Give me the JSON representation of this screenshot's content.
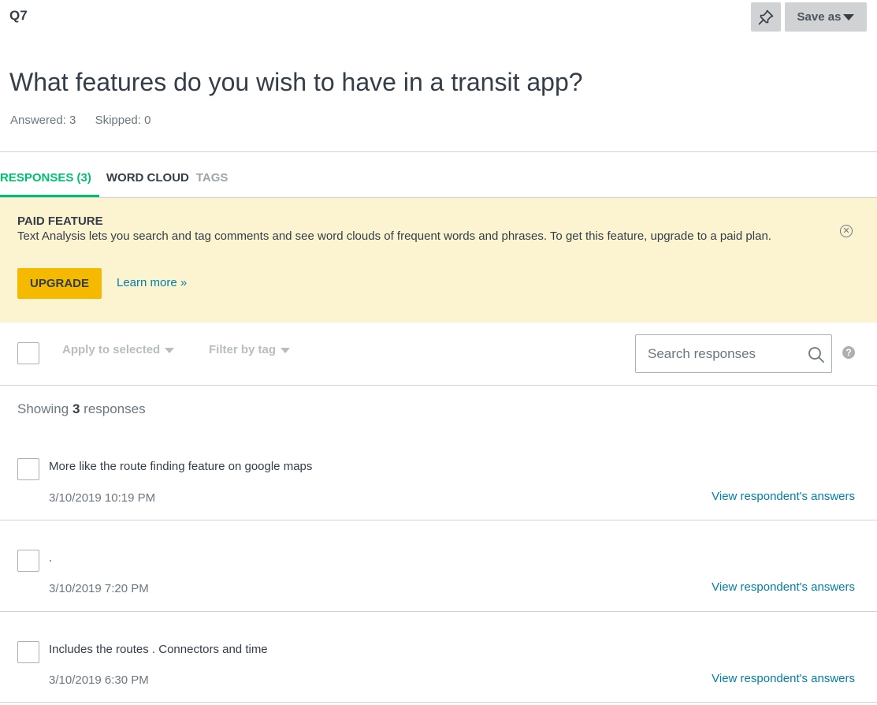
{
  "question": {
    "number": "Q7",
    "title": "What features do you wish to have in a transit app?",
    "answered": "Answered: 3",
    "skipped": "Skipped: 0"
  },
  "header": {
    "save_as_label": "Save as",
    "pin_icon": "pin-icon"
  },
  "tabs": [
    {
      "label": "RESPONSES (3)",
      "state": "active"
    },
    {
      "label": "WORD CLOUD",
      "state": "normal"
    },
    {
      "label": "TAGS",
      "state": "muted"
    }
  ],
  "paid_banner": {
    "title": "PAID FEATURE",
    "text": "Text Analysis lets you search and tag comments and see word clouds of frequent words and phrases. To get this feature, upgrade to a paid plan.",
    "upgrade_label": "UPGRADE",
    "learn_more_label": "Learn more »",
    "close_icon": "close-circle-icon"
  },
  "toolbar": {
    "apply_label": "Apply to selected",
    "filter_label": "Filter by tag",
    "search_placeholder": "Search responses",
    "help_label": "?"
  },
  "summary": {
    "prefix": "Showing",
    "count": "3",
    "suffix": "responses"
  },
  "responses": [
    {
      "text": "More like the route finding feature on google maps",
      "date": "3/10/2019 10:19 PM",
      "link": "View respondent's answers"
    },
    {
      "text": ".",
      "date": "3/10/2019 7:20 PM",
      "link": "View respondent's answers"
    },
    {
      "text": "Includes the routes . Connectors and time",
      "date": "3/10/2019 6:30 PM",
      "link": "View respondent's answers"
    }
  ],
  "colors": {
    "accent_green": "#00bf6f",
    "banner_bg": "#fcf3d0",
    "upgrade_yellow": "#f5ba00",
    "link_blue": "#007faa"
  }
}
